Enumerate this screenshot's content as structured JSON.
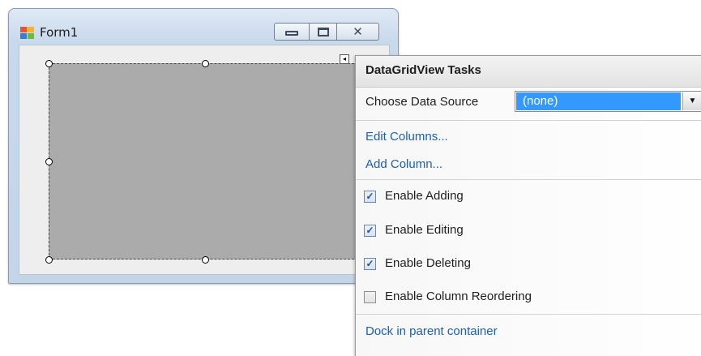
{
  "form": {
    "title": "Form1",
    "close_glyph": "✕"
  },
  "grid": {
    "smart_tag_glyph": "◂"
  },
  "tasks": {
    "title": "DataGridView Tasks",
    "data_source_label": "Choose Data Source",
    "data_source_value": "(none)",
    "dropdown_glyph": "▼",
    "edit_columns": "Edit Columns...",
    "add_column": "Add Column...",
    "check_glyph": "✓",
    "options": [
      {
        "label": "Enable Adding",
        "checked": true
      },
      {
        "label": "Enable Editing",
        "checked": true
      },
      {
        "label": "Enable Deleting",
        "checked": true
      },
      {
        "label": "Enable Column Reordering",
        "checked": false
      }
    ],
    "dock": "Dock in parent container"
  },
  "icons": {
    "app": "form-app-icon",
    "minimize": "minimize-icon",
    "maximize": "maximize-icon",
    "close": "close-icon",
    "dropdown": "chevron-down-icon",
    "smart_tag": "smart-tag-arrow-icon"
  },
  "colors": {
    "selection": "#3399ff",
    "link": "#1c5fb0",
    "grid_background": "#ababab"
  }
}
